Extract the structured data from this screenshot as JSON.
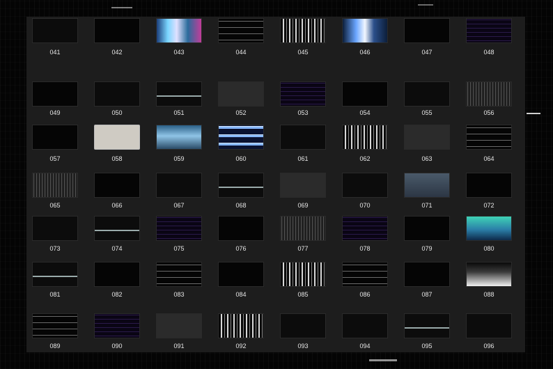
{
  "gallery": {
    "tiles": [
      {
        "label": "041",
        "style": "t-dark"
      },
      {
        "label": "042",
        "style": "t-black"
      },
      {
        "label": "043",
        "style": "t-rgb"
      },
      {
        "label": "044",
        "style": "t-lines"
      },
      {
        "label": "045",
        "style": "t-bars"
      },
      {
        "label": "046",
        "style": "t-wave"
      },
      {
        "label": "047",
        "style": "t-black"
      },
      {
        "label": "048",
        "style": "t-noise-purple"
      },
      {
        "label": "049",
        "style": "t-black"
      },
      {
        "label": "050",
        "style": "t-dark"
      },
      {
        "label": "051",
        "style": "t-dark t-line-mid"
      },
      {
        "label": "052",
        "style": "t-gray"
      },
      {
        "label": "053",
        "style": "t-noise-purple"
      },
      {
        "label": "054",
        "style": "t-black"
      },
      {
        "label": "055",
        "style": "t-dark"
      },
      {
        "label": "056",
        "style": "t-static"
      },
      {
        "label": "057",
        "style": "t-black"
      },
      {
        "label": "058",
        "style": "t-silver"
      },
      {
        "label": "059",
        "style": "t-blue"
      },
      {
        "label": "060",
        "style": "t-blue-stripes"
      },
      {
        "label": "061",
        "style": "t-dark"
      },
      {
        "label": "062",
        "style": "t-bars"
      },
      {
        "label": "063",
        "style": "t-gray"
      },
      {
        "label": "064",
        "style": "t-lines"
      },
      {
        "label": "065",
        "style": "t-static"
      },
      {
        "label": "066",
        "style": "t-black"
      },
      {
        "label": "067",
        "style": "t-dark"
      },
      {
        "label": "068",
        "style": "t-dark t-line-mid"
      },
      {
        "label": "069",
        "style": "t-gray"
      },
      {
        "label": "070",
        "style": "t-dark"
      },
      {
        "label": "071",
        "style": "t-slate"
      },
      {
        "label": "072",
        "style": "t-black"
      },
      {
        "label": "073",
        "style": "t-dark"
      },
      {
        "label": "074",
        "style": "t-dark t-line-mid"
      },
      {
        "label": "075",
        "style": "t-noise-purple"
      },
      {
        "label": "076",
        "style": "t-black"
      },
      {
        "label": "077",
        "style": "t-static"
      },
      {
        "label": "078",
        "style": "t-noise-purple"
      },
      {
        "label": "079",
        "style": "t-black"
      },
      {
        "label": "080",
        "style": "t-cyan"
      },
      {
        "label": "081",
        "style": "t-dark t-line-mid"
      },
      {
        "label": "082",
        "style": "t-black"
      },
      {
        "label": "083",
        "style": "t-lines"
      },
      {
        "label": "084",
        "style": "t-black"
      },
      {
        "label": "085",
        "style": "t-bars"
      },
      {
        "label": "086",
        "style": "t-lines"
      },
      {
        "label": "087",
        "style": "t-black"
      },
      {
        "label": "088",
        "style": "t-grad"
      },
      {
        "label": "089",
        "style": "t-lines"
      },
      {
        "label": "090",
        "style": "t-noise-purple"
      },
      {
        "label": "091",
        "style": "t-gray"
      },
      {
        "label": "092",
        "style": "t-bars"
      },
      {
        "label": "093",
        "style": "t-dark"
      },
      {
        "label": "094",
        "style": "t-dark"
      },
      {
        "label": "095",
        "style": "t-dark t-line-mid"
      },
      {
        "label": "096",
        "style": "t-dark"
      }
    ]
  }
}
